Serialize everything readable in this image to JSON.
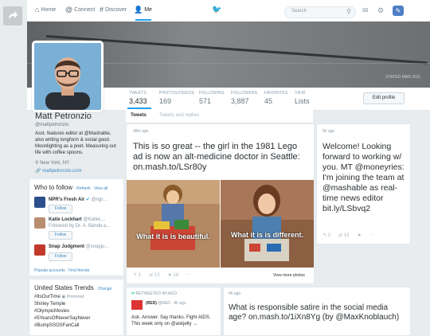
{
  "nav": {
    "home": "Home",
    "connect": "Connect",
    "discover": "Discover",
    "me": "Me",
    "search_placeholder": "Search"
  },
  "banner": {
    "credit": "STATED MAR 2011"
  },
  "profile": {
    "name": "Matt Petronzio",
    "handle": "@mattpetronzio",
    "bio": "Asst. features editor at @Mashable, also writing longform & social good. Moonlighting as a poet. Measuring out life with coffee spoons.",
    "location": "New York, NY",
    "url": "mattpetronzio.com",
    "edit_label": "Edit profile"
  },
  "stats": [
    {
      "label": "TWEETS",
      "value": "3,433"
    },
    {
      "label": "PHOTOS/VIDEOS",
      "value": "169"
    },
    {
      "label": "FOLLOWING",
      "value": "571"
    },
    {
      "label": "FOLLOWERS",
      "value": "3,887"
    },
    {
      "label": "FAVORITES",
      "value": "45"
    },
    {
      "label": "VIEW",
      "value": "Lists"
    }
  ],
  "timeline_tabs": {
    "tweets": "Tweets",
    "replies": "Tweets and replies"
  },
  "who_to_follow": {
    "title": "Who to follow",
    "refresh": "· Refresh · View all",
    "items": [
      {
        "name": "NPR's Fresh Air",
        "handle": "@ngr...",
        "sub": "",
        "follow": "Follow"
      },
      {
        "name": "Katie Lockhart",
        "handle": "@KatieL...",
        "sub": "Followed by Dr. A. Banda a...",
        "follow": "Follow"
      },
      {
        "name": "Snap Judgment",
        "handle": "@snapju...",
        "sub": "",
        "follow": "Follow"
      }
    ],
    "footer": "Popular accounts · Find friends"
  },
  "trends": {
    "title": "United States Trends",
    "change": "· Change",
    "items": [
      "#ItsOurTime",
      "Shirley Temple",
      "#OlympicMovies",
      "#5YearsOfNeverSayNever",
      "#BumpSSOSFanCall"
    ],
    "promoted": "Promoted"
  },
  "tweets": {
    "main": {
      "time": "38m ago",
      "text": "This is so great -- the girl in the 1981 Lego ad is now an alt-medicine doctor in Seattle: on.mash.to/LSr80y",
      "photo_left_caption": "What it is is beautiful.",
      "photo_right_caption": "What it is is different.",
      "reply_count": "1",
      "retweet_count": "13",
      "fav_count": "18",
      "view_more": "View more photos"
    },
    "retweeted": {
      "header": "RETWEETED 4H AGO",
      "author": "(RED)",
      "author_handle": "@RED · 4h ago",
      "text": "Ask. Answer. Say thanks. Fight AIDS. This week only on @askjelly →"
    },
    "satire": {
      "time": "4h ago",
      "text": "What is responsible satire in the social media age? on.mash.to/1iXn8Yg (by @MaxKnoblauch)"
    },
    "welcome": {
      "time": "5h ago",
      "text": "Welcome! Looking forward to working w/ you. MT @moneyries: I'm joining the team at @mashable as real-time news editor bit.ly/LSbvq2",
      "reply_count": "2",
      "retweet_count": "13"
    }
  }
}
